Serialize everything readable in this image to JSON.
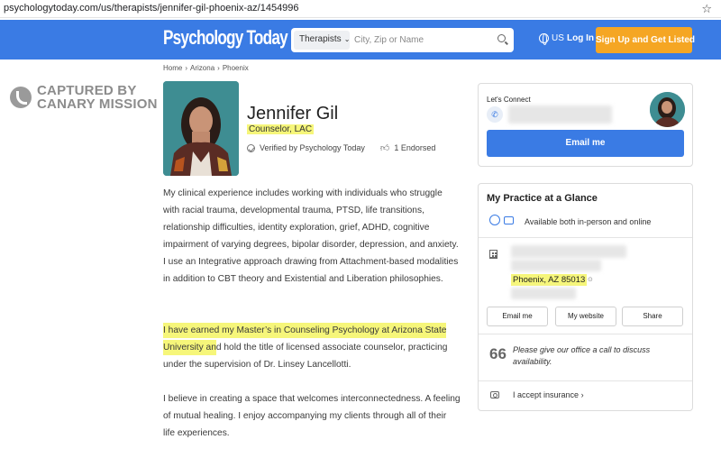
{
  "browser": {
    "url": "psychologytoday.com/us/therapists/jennifer-gil-phoenix-az/1454996",
    "star_glyph": "☆"
  },
  "header": {
    "logo": "Psychology Today",
    "search_category": "Therapists",
    "search_placeholder": "City, Zip or Name",
    "locale": "US",
    "login": "Log In",
    "signup": "Sign Up and Get Listed",
    "brand_color": "#3a7be4",
    "accent_color": "#f5a623"
  },
  "breadcrumb": [
    "Home",
    "Arizona",
    "Phoenix"
  ],
  "watermark": {
    "line1": "CAPTURED BY",
    "line2": "CANARY MISSION"
  },
  "profile": {
    "name": "Jennifer Gil",
    "title": "Counselor, LAC",
    "verified": "Verified by Psychology Today",
    "endorsed": "1 Endorsed"
  },
  "bio": {
    "p1": "My clinical experience includes working with individuals who struggle with racial trauma, developmental trauma, PTSD, life transitions, relationship difficulties, identity exploration, grief, ADHD, cognitive impairment of varying degrees, bipolar disorder, depression, and anxiety. I use an Integrative approach drawing from Attachment-based modalities in addition to CBT theory and Existential and Liberation philosophies.",
    "p2_highlight": "I have earned my Master’s in Counseling Psychology at Arizona State University an",
    "p2_rest": "d hold the title of licensed associate counselor, practicing under the supervision of Dr. Linsey Lancellotti.",
    "p3": "I believe in creating a space that welcomes interconnectedness. A feeling of mutual healing. I enjoy accompanying my clients through all of their life experiences."
  },
  "connect": {
    "label": "Let's Connect",
    "email_button": "Email me"
  },
  "practice": {
    "title": "My Practice at a Glance",
    "availability": "Available both in-person and online",
    "city": "Phoenix, AZ 85013",
    "buttons": [
      "Email me",
      "My website",
      "Share"
    ],
    "call_note": "Please give our office a call to discuss availability.",
    "insurance": "I accept insurance",
    "insurance_chevron": "›"
  }
}
